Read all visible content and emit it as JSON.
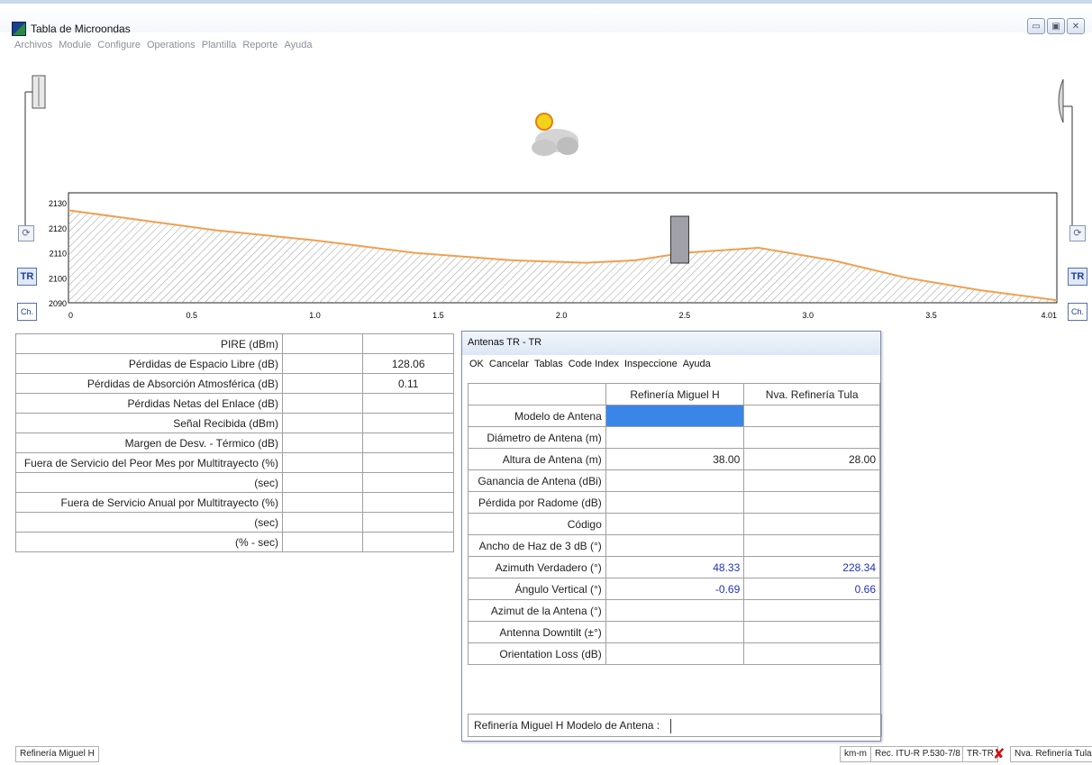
{
  "window": {
    "title": "Tabla de Microondas",
    "controls": [
      "minimize",
      "maximize",
      "close"
    ]
  },
  "menu": [
    "Archivos",
    "Module",
    "Configure",
    "Operations",
    "Plantilla",
    "Reporte",
    "Ayuda"
  ],
  "profile": {
    "y_ticks": [
      "2130",
      "2120",
      "2110",
      "2100",
      "2090"
    ],
    "x_ticks": [
      "0",
      "0.5",
      "1.0",
      "1.5",
      "2.0",
      "2.5",
      "3.0",
      "3.5",
      "4.01"
    ],
    "left_buttons": {
      "tr": "TR",
      "ch": "Ch."
    },
    "right_buttons": {
      "tr": "TR",
      "ch": "Ch."
    },
    "terrain_color": "#f0a050",
    "obstacle_color": "#a0a0a8"
  },
  "results": {
    "rows": [
      {
        "label": "PIRE (dBm)",
        "v1": "",
        "v2": ""
      },
      {
        "label": "Pérdidas de Espacio Libre (dB)",
        "v1": "",
        "v2": "128.06"
      },
      {
        "label": "Pérdidas de Absorción Atmosférica (dB)",
        "v1": "",
        "v2": "0.11"
      },
      {
        "label": "Pérdidas Netas del Enlace (dB)",
        "v1": "",
        "v2": ""
      },
      {
        "label": "Señal Recibida (dBm)",
        "v1": "",
        "v2": ""
      },
      {
        "label": "Margen de Desv. - Térmico (dB)",
        "v1": "",
        "v2": ""
      },
      {
        "label": "Fuera de Servicio del Peor Mes por Multitrayecto (%)",
        "v1": "",
        "v2": ""
      },
      {
        "label": "(sec)",
        "v1": "",
        "v2": ""
      },
      {
        "label": "Fuera de Servicio Anual por Multitrayecto (%)",
        "v1": "",
        "v2": ""
      },
      {
        "label": "(sec)",
        "v1": "",
        "v2": ""
      },
      {
        "label": "(% - sec)",
        "v1": "",
        "v2": ""
      }
    ]
  },
  "dialog": {
    "title": "Antenas TR - TR",
    "menu": [
      "OK",
      "Cancelar",
      "Tablas",
      "Code Index",
      "Inspeccione",
      "Ayuda"
    ],
    "col1": "Refinería Miguel H",
    "col2": "Nva. Refinería Tula",
    "rows": [
      {
        "label": "Modelo de Antena",
        "c1": "",
        "c2": ""
      },
      {
        "label": "Diámetro de Antena (m)",
        "c1": "",
        "c2": ""
      },
      {
        "label": "Altura de Antena (m)",
        "c1": "38.00",
        "c2": "28.00"
      },
      {
        "label": "Ganancia de Antena (dBi)",
        "c1": "",
        "c2": ""
      },
      {
        "label": "Pérdida por Radome (dB)",
        "c1": "",
        "c2": ""
      },
      {
        "label": "Código",
        "c1": "",
        "c2": ""
      },
      {
        "label": "Ancho de Haz de 3 dB (°)",
        "c1": "",
        "c2": ""
      },
      {
        "label": "Azimuth Verdadero (°)",
        "c1": "48.33",
        "c2": "228.34"
      },
      {
        "label": "Ángulo Vertical (°)",
        "c1": "-0.69",
        "c2": "0.66"
      },
      {
        "label": "Azimut de la Antena (°)",
        "c1": "",
        "c2": ""
      },
      {
        "label": "Antenna Downtilt (±°)",
        "c1": "",
        "c2": ""
      },
      {
        "label": "Orientation Loss (dB)",
        "c1": "",
        "c2": ""
      }
    ],
    "model_label": "Refinería Miguel H Modelo de Antena :"
  },
  "status": {
    "left": "Refinería Miguel H",
    "units": "km-m",
    "rec": "Rec. ITU-R P.530-7/8",
    "link": "TR-TR",
    "right": "Nva. Refinería Tula"
  }
}
